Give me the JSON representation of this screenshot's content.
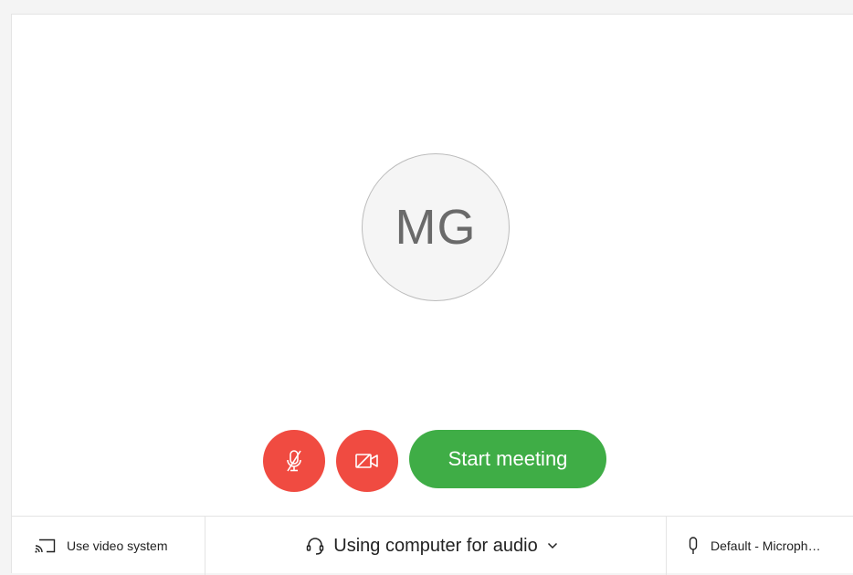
{
  "avatar": {
    "initials": "MG"
  },
  "controls": {
    "mute_icon": "mic-off-icon",
    "video_icon": "video-off-icon",
    "start_label": "Start meeting"
  },
  "bottom": {
    "video_system_label": "Use video system",
    "audio_label": "Using computer for audio",
    "microphone_label": "Default - Microphone"
  },
  "colors": {
    "mute_red": "#f04b41",
    "start_green": "#3fad46"
  }
}
